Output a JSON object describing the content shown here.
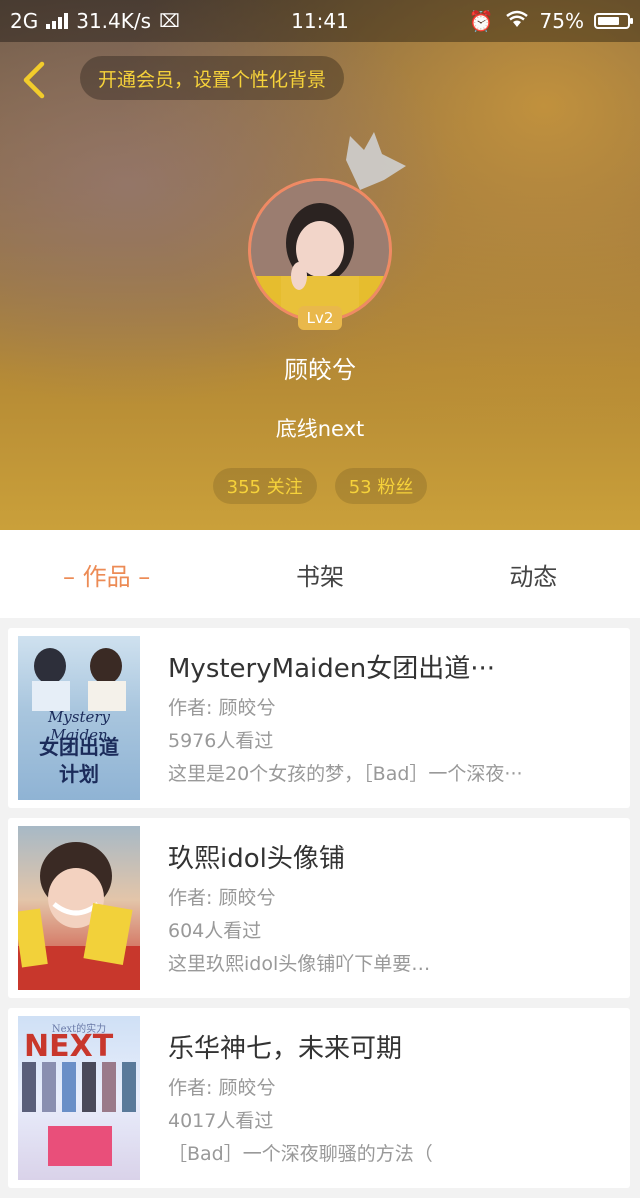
{
  "status_bar": {
    "network": "2G",
    "speed": "31.4K/s",
    "time": "11:41",
    "battery": "75%",
    "battery_level": 0.75
  },
  "header": {
    "vip_prompt": "开通会员，设置个性化背景",
    "level_badge": "Lv2",
    "user_name": "顾皎兮",
    "signature": "底线next",
    "following": "355 关注",
    "followers": "53 粉丝"
  },
  "tabs": [
    {
      "label": "– 作品 –",
      "active": true
    },
    {
      "label": "书架",
      "active": false
    },
    {
      "label": "动态",
      "active": false
    }
  ],
  "works": [
    {
      "title": "MysteryMaiden女团出道···",
      "author": "作者: 顾皎兮",
      "views": "5976人看过",
      "desc": "这里是20个女孩的梦，［Bad］一个深夜···",
      "cover_lines": [
        "Mystery Maiden",
        "女团出道",
        "计划"
      ]
    },
    {
      "title": "玖熙idol头像铺",
      "author": "作者: 顾皎兮",
      "views": "604人看过",
      "desc": "这里玖熙idol头像铺吖下单要…",
      "cover_lines": []
    },
    {
      "title": "乐华神七，未来可期",
      "author": "作者: 顾皎兮",
      "views": "4017人看过",
      "desc": "［Bad］一个深夜聊骚的方法（",
      "cover_lines": [
        "Next的实力"
      ]
    }
  ]
}
